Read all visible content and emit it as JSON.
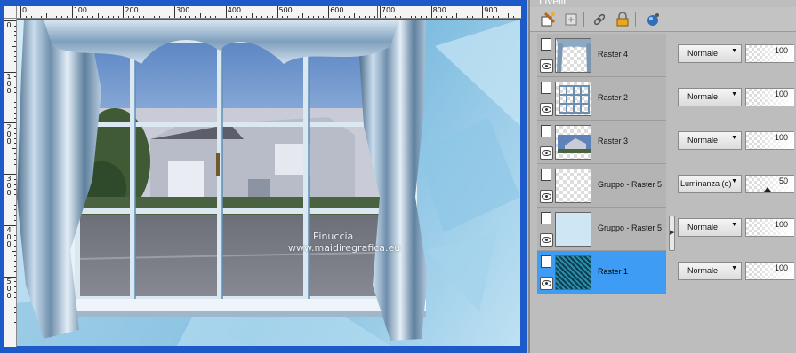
{
  "canvas": {
    "ruler_h_labels": [
      "0",
      "100",
      "200",
      "300",
      "400",
      "500",
      "600",
      "700",
      "800",
      "900"
    ],
    "ruler_v_labels": [
      "0",
      "1 0 0",
      "2 0 0",
      "3 0 0",
      "4 0 0",
      "5 0 0"
    ],
    "watermark_line1": "Pinuccia",
    "watermark_line2": "www.maidiregrafica.eu"
  },
  "panel": {
    "title": "Livelli",
    "toolbar_icons": [
      "new-raster-layer-icon",
      "new-layer-icon",
      "link-icon",
      "lock-icon",
      "mask-icon"
    ]
  },
  "layers": [
    {
      "name": "Raster 4",
      "blend": "Normale",
      "opacity": "100",
      "selected": false
    },
    {
      "name": "Raster 2",
      "blend": "Normale",
      "opacity": "100",
      "selected": false
    },
    {
      "name": "Raster 3",
      "blend": "Normale",
      "opacity": "100",
      "selected": false
    },
    {
      "name": "Gruppo - Raster 5",
      "blend": "Luminanza (e)",
      "opacity": "50",
      "selected": false
    },
    {
      "name": "Gruppo - Raster 5",
      "blend": "Normale",
      "opacity": "100",
      "selected": false
    },
    {
      "name": "Raster 1",
      "blend": "Normale",
      "opacity": "100",
      "selected": true
    }
  ],
  "colors": {
    "selected_row": "#3e9cf5",
    "window_frame": "#1c59c9"
  }
}
